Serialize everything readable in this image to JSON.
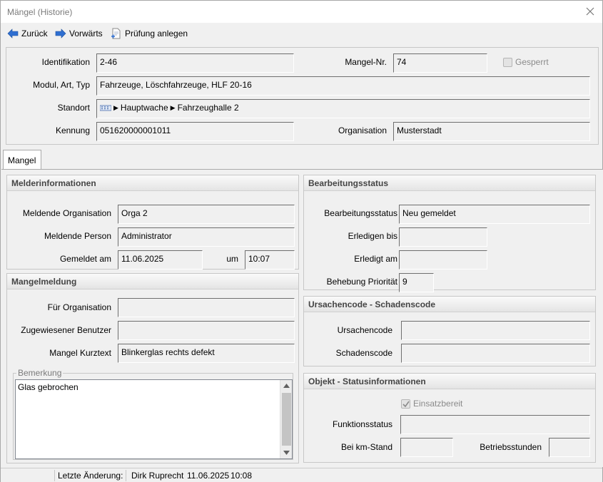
{
  "window": {
    "title": "Mängel (Historie)"
  },
  "toolbar": {
    "back": "Zurück",
    "forward": "Vorwärts",
    "create_check": "Prüfung anlegen"
  },
  "header": {
    "identifikation_label": "Identifikation",
    "identifikation": "2-46",
    "mangel_nr_label": "Mangel-Nr.",
    "mangel_nr": "74",
    "gesperrt_label": "Gesperrt",
    "modul_label": "Modul, Art, Typ",
    "modul": "Fahrzeuge, Löschfahrzeuge, HLF 20-16",
    "standort_label": "Standort",
    "standort_1": "Hauptwache",
    "standort_2": "Fahrzeughalle 2",
    "kennung_label": "Kennung",
    "kennung": "051620000001011",
    "organisation_label": "Organisation",
    "organisation": "Musterstadt"
  },
  "tab": {
    "label": "Mangel"
  },
  "melder": {
    "title": "Melderinformationen",
    "org_label": "Meldende Organisation",
    "org": "Orga 2",
    "person_label": "Meldende Person",
    "person": "Administrator",
    "date_label": "Gemeldet am",
    "date": "11.06.2025",
    "time_label": "um",
    "time": "10:07"
  },
  "mangelmeldung": {
    "title": "Mangelmeldung",
    "fuer_org_label": "Für Organisation",
    "fuer_org": "",
    "user_label": "Zugewiesener Benutzer",
    "user": "",
    "kurz_label": "Mangel Kurztext",
    "kurz": "Blinkerglas rechts defekt",
    "bemerkung_label": "Bemerkung",
    "bemerkung": "Glas gebrochen"
  },
  "bearbeitung": {
    "title": "Bearbeitungsstatus",
    "status_label": "Bearbeitungsstatus",
    "status": "Neu gemeldet",
    "bis_label": "Erledigen bis",
    "bis": "",
    "am_label": "Erledigt am",
    "am": "",
    "prio_label": "Behebung Priorität",
    "prio": "9"
  },
  "codes": {
    "title": "Ursachencode - Schadenscode",
    "ursache_label": "Ursachencode",
    "ursache": "",
    "schaden_label": "Schadenscode",
    "schaden": ""
  },
  "objekt": {
    "title": "Objekt - Statusinformationen",
    "einsatz_label": "Einsatzbereit",
    "funktion_label": "Funktionsstatus",
    "funktion": "",
    "km_label": "Bei km-Stand",
    "km": "",
    "betrieb_label": "Betriebsstunden",
    "betrieb": ""
  },
  "status": {
    "label": "Letzte Änderung:",
    "user": "Dirk Ruprecht",
    "date": "11.06.2025",
    "time": "10:08"
  },
  "colors": {
    "arrow": "#2f6fd1",
    "field_border": "#6f6f6f"
  }
}
